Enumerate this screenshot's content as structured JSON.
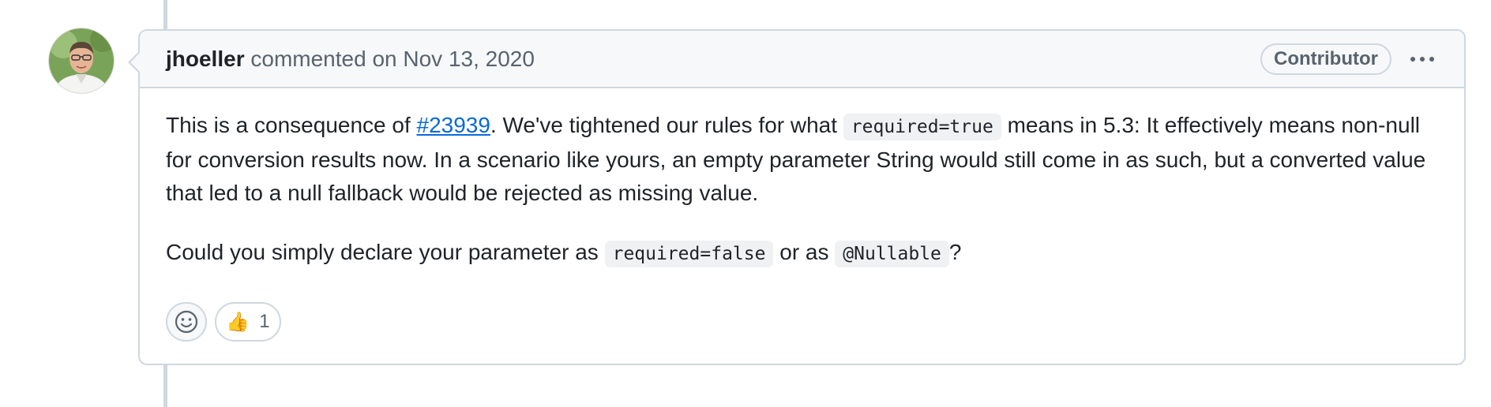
{
  "comment": {
    "author": "jhoeller",
    "action_text": " commented on ",
    "timestamp": "Nov 13, 2020",
    "role_badge": "Contributor",
    "body": {
      "p1_text_1": "This is a consequence of ",
      "p1_link": "#23939",
      "p1_text_2": ". We've tightened our rules for what ",
      "p1_code": "required=true",
      "p1_text_3": " means in 5.3: It effectively means non-null for conversion results now. In a scenario like yours, an empty parameter String would still come in as such, but a converted value that led to a null fallback would be rejected as missing value.",
      "p2_text_1": "Could you simply declare your parameter as ",
      "p2_code_1": "required=false",
      "p2_text_2": " or as ",
      "p2_code_2": "@Nullable",
      "p2_text_3": "?"
    },
    "reactions": [
      {
        "icon": "thumbs-up-icon",
        "emoji": "👍",
        "count": "1"
      }
    ]
  },
  "colors": {
    "link": "#0969da",
    "border": "#d0d7de",
    "header_bg": "#f6f8fa",
    "muted_text": "#59636e"
  }
}
